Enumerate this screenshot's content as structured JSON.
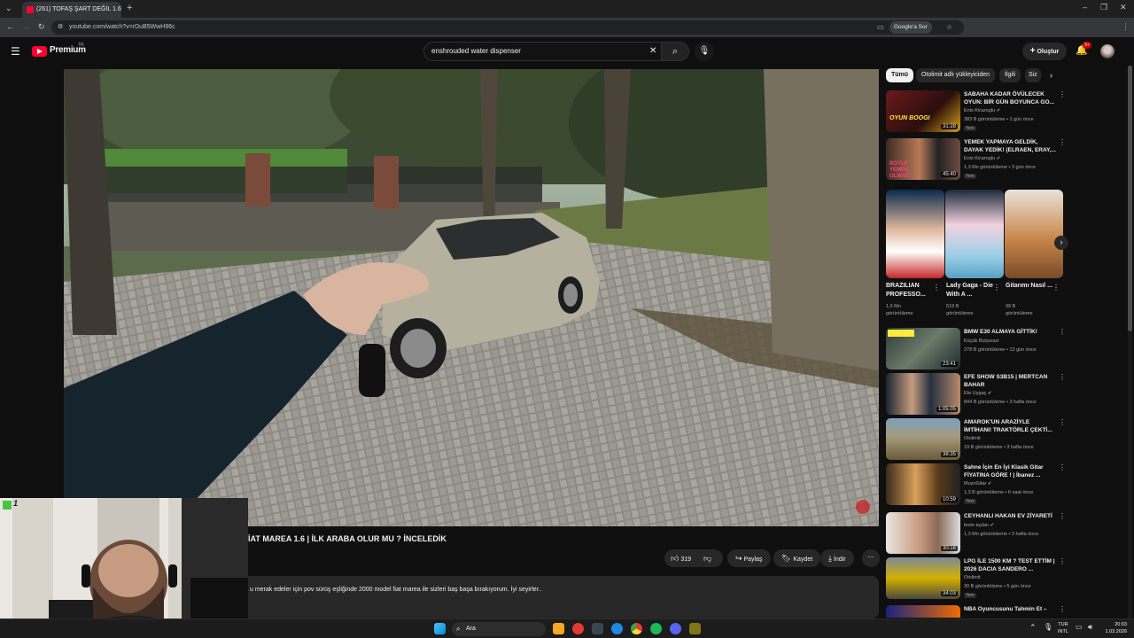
{
  "browser": {
    "tab_title": "(261) TOFAŞ ŞART DEĞİL 1.6",
    "url": "youtube.com/watch?v=rDuB5WwH96c",
    "google_button": "Google'a Sor"
  },
  "header": {
    "brand": "Premium",
    "brand_sup": "TR",
    "search_query": "enshrouded water dispenser",
    "create_label": "Oluştur",
    "notification_count": "9+"
  },
  "video": {
    "title": "İAT MAREA 1.6 | İLK ARABA OLUR MU ? İNCELEDİK",
    "likes": "319",
    "share_label": "Paylaş",
    "save_label": "Kaydet",
    "download_label": "İndir",
    "description": "u merak edeler için pov sürüş eşliğinde 2000 model fiat marea ile sizleri baş başa bırakıyorum. İyi seyirler.."
  },
  "webcam": {
    "overlay_label": "1"
  },
  "chips": [
    "Tümü",
    "Otolimit adlı yükleyiciden",
    "İlgili",
    "Siz"
  ],
  "recommendations_top": [
    {
      "title": "SABAHA KADAR ÖVÜLECEK OYUN: BİR GÜN BOYUNCA GO...",
      "channel": "Enis Kirazoglu",
      "meta": "383 B görüntüleme • 1 gün önce",
      "badge": "Yeni",
      "duration": "31:28",
      "thumb_text": "OYUN BOOGI"
    },
    {
      "title": "YEMEK YAPMAYA GELDİK, DAYAK YEDİK! (ELRAEN, ERAY,...",
      "channel": "Enis Kirazoglu",
      "meta": "1,3 Mn görüntüleme • 3 gün önce",
      "badge": "Yeni",
      "duration": "45:40",
      "thumb_text": "BÖYLE YEMEK OLMAZ!"
    }
  ],
  "shorts": [
    {
      "title": "BRAZILIAN PROFESSO...",
      "views": "1,6 Mn",
      "views_label": "görüntüleme"
    },
    {
      "title": "Lady Gaga - Die With A ...",
      "views": "519 B",
      "views_label": "görüntüleme"
    },
    {
      "title": "Gitarımı Nasıl ...",
      "views": "99 B",
      "views_label": "görüntüleme"
    }
  ],
  "recommendations_bottom": [
    {
      "title": "BMW E30 ALMAYA GİTTİK!",
      "channel": "Küçük Burjuvazi",
      "meta": "278 B görüntüleme • 13 gün önce",
      "badge": "",
      "duration": "23:41"
    },
    {
      "title": "EFE SHOW S3B15 | MERTCAN BAHAR",
      "channel": "Efe Uygaç",
      "meta": "844 B görüntüleme • 3 hafta önce",
      "badge": "",
      "duration": "1:05:05"
    },
    {
      "title": "AMAROK'UN ARAZİYLE İMTİHANI! TRAKTÖRLE ÇEKTİ...",
      "channel": "Otolimit",
      "meta": "19 B görüntüleme • 3 hafta önce",
      "badge": "",
      "duration": "38:35"
    },
    {
      "title": "Sahne İçin En İyi Klasik Gitar FİYATINA GÖRE ! | İbanez ...",
      "channel": "MuzoGitar",
      "meta": "1,3 B görüntüleme • 6 saat önce",
      "badge": "Yeni",
      "duration": "10:59"
    },
    {
      "title": "CEYHANLI HAKAN EV ZİYARETİ",
      "channel": "testo taylan",
      "meta": "1,3 Mn görüntüleme • 3 hafta önce",
      "badge": "",
      "duration": "30:16"
    },
    {
      "title": "LPG İLE 1500 KM ? TEST ETTİM | 2026 DACIA SANDERO ...",
      "channel": "Otolimit",
      "meta": "30 B görüntüleme • 5 gün önce",
      "badge": "Yeni",
      "duration": "34:03"
    },
    {
      "title": "NBA Oyuncusunu Tahmin Et –",
      "channel": "",
      "meta": "",
      "badge": "",
      "duration": ""
    }
  ],
  "taskbar": {
    "search_placeholder": "Ara",
    "lang_top": "TUR",
    "lang_bottom": "INTL",
    "time": "20:03",
    "date": "1.03.2026"
  },
  "colors": {
    "accent": "#ff0033",
    "bg": "#0f0f0f",
    "chip_active": "#f1f1f1"
  }
}
